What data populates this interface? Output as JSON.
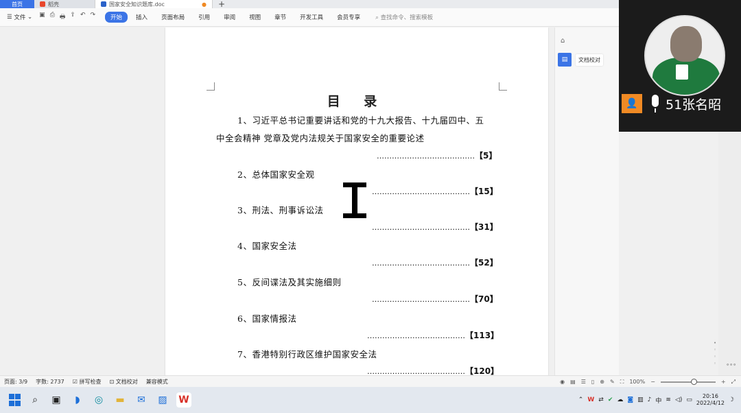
{
  "tabs": {
    "home": "首页",
    "daoke": "稻壳",
    "doc": "国家安全知识题库.doc",
    "new_tab": "+"
  },
  "ribbon": {
    "file_menu": "文件",
    "tabs": [
      "开始",
      "插入",
      "页面布局",
      "引用",
      "审阅",
      "视图",
      "章节",
      "开发工具",
      "会员专享"
    ],
    "search": "查找命令、搜索模板"
  },
  "document": {
    "title": "目  录",
    "entries": [
      {
        "text_lines": [
          "1、习近平总书记重要讲话和党的十九大报告、十九届四中、五",
          "中全会精神  党章及党内法规关于国家安全的重要论述"
        ],
        "page": "【5】"
      },
      {
        "text_lines": [
          "2、总体国家安全观"
        ],
        "page": "【15】"
      },
      {
        "text_lines": [
          "3、刑法、刑事诉讼法"
        ],
        "page": "【31】"
      },
      {
        "text_lines": [
          "4、国家安全法"
        ],
        "page": "【52】"
      },
      {
        "text_lines": [
          "5、反间谍法及其实施细则"
        ],
        "page": "【70】"
      },
      {
        "text_lines": [
          "6、国家情报法"
        ],
        "page": "【113】"
      },
      {
        "text_lines": [
          "7、香港特别行政区维护国家安全法"
        ],
        "page": "【120】"
      }
    ],
    "leader_dots": "…………………………………"
  },
  "sidepanel": {
    "doc_proof_label": "文档校对"
  },
  "video": {
    "name": "51张名昭"
  },
  "statusbar": {
    "page": "页面: 3/9",
    "words": "字数: 2737",
    "spellcheck": "拼写检查",
    "doc_proof": "文档校对",
    "compat": "兼容模式",
    "zoom": "100%"
  },
  "taskbar": {
    "ime": "中",
    "time": "20:16",
    "date": "2022/4/12"
  },
  "colors": {
    "accent": "#3b74e6",
    "video_badge": "#f08a24"
  }
}
